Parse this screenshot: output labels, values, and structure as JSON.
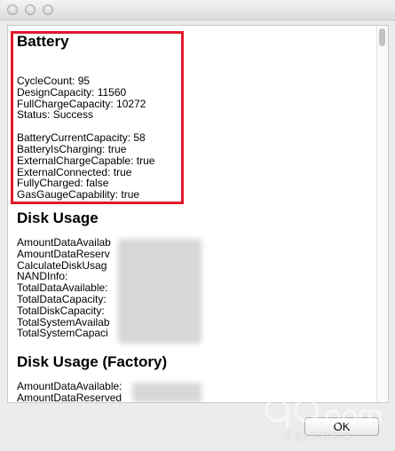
{
  "battery": {
    "heading": "Battery",
    "group1": [
      "CycleCount: 95",
      "DesignCapacity: 11560",
      "FullChargeCapacity: 10272",
      "Status: Success"
    ],
    "group2": [
      "BatteryCurrentCapacity: 58",
      "BatteryIsCharging: true",
      "ExternalChargeCapable: true",
      "ExternalConnected: true",
      "FullyCharged: false",
      "GasGaugeCapability: true"
    ]
  },
  "disk_usage": {
    "heading": "Disk Usage",
    "lines": [
      "AmountDataAvailab",
      "AmountDataReserv",
      "CalculateDiskUsag",
      "NANDInfo:",
      "TotalDataAvailable:",
      "TotalDataCapacity:",
      "TotalDiskCapacity:",
      "TotalSystemAvailab",
      "TotalSystemCapaci"
    ]
  },
  "disk_usage_factory": {
    "heading": "Disk Usage (Factory)",
    "lines": [
      "AmountDataAvailable:",
      "AmountDataReserved"
    ]
  },
  "footer": {
    "ok_label": "OK",
    "watermark_text": "百度|手机频道"
  },
  "colors": {
    "highlight": "#e0192b"
  },
  "icons": [
    "close-icon",
    "minimize-icon",
    "zoom-icon",
    "watermark-logo-icon"
  ]
}
